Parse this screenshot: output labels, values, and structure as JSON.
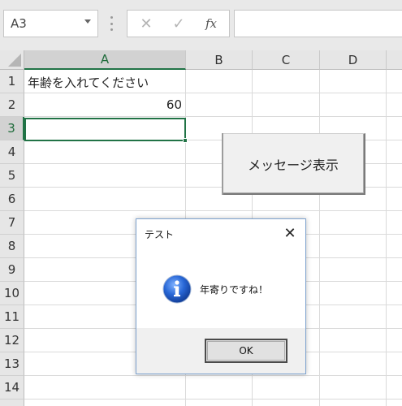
{
  "formula_bar": {
    "name_box": "A3",
    "cancel_glyph": "✕",
    "enter_glyph": "✓",
    "fx_label": "fx",
    "formula": ""
  },
  "sheet": {
    "columns": [
      "A",
      "B",
      "C",
      "D"
    ],
    "rows": [
      "1",
      "2",
      "3",
      "4",
      "5",
      "6",
      "7",
      "8",
      "9",
      "10",
      "11",
      "12",
      "13",
      "14"
    ],
    "active_cell": "A3",
    "cells": {
      "A1": "年齢を入れてください",
      "A2": "60"
    }
  },
  "sheet_button": {
    "label": "メッセージ表示"
  },
  "dialog": {
    "title": "テスト",
    "message": "年寄りですね！",
    "icon": "information-icon",
    "ok_label": "OK",
    "close_glyph": "✕"
  },
  "colors": {
    "excel_green": "#217346",
    "dialog_border": "#7da2ce",
    "info_blue": "#1e5fc2"
  }
}
